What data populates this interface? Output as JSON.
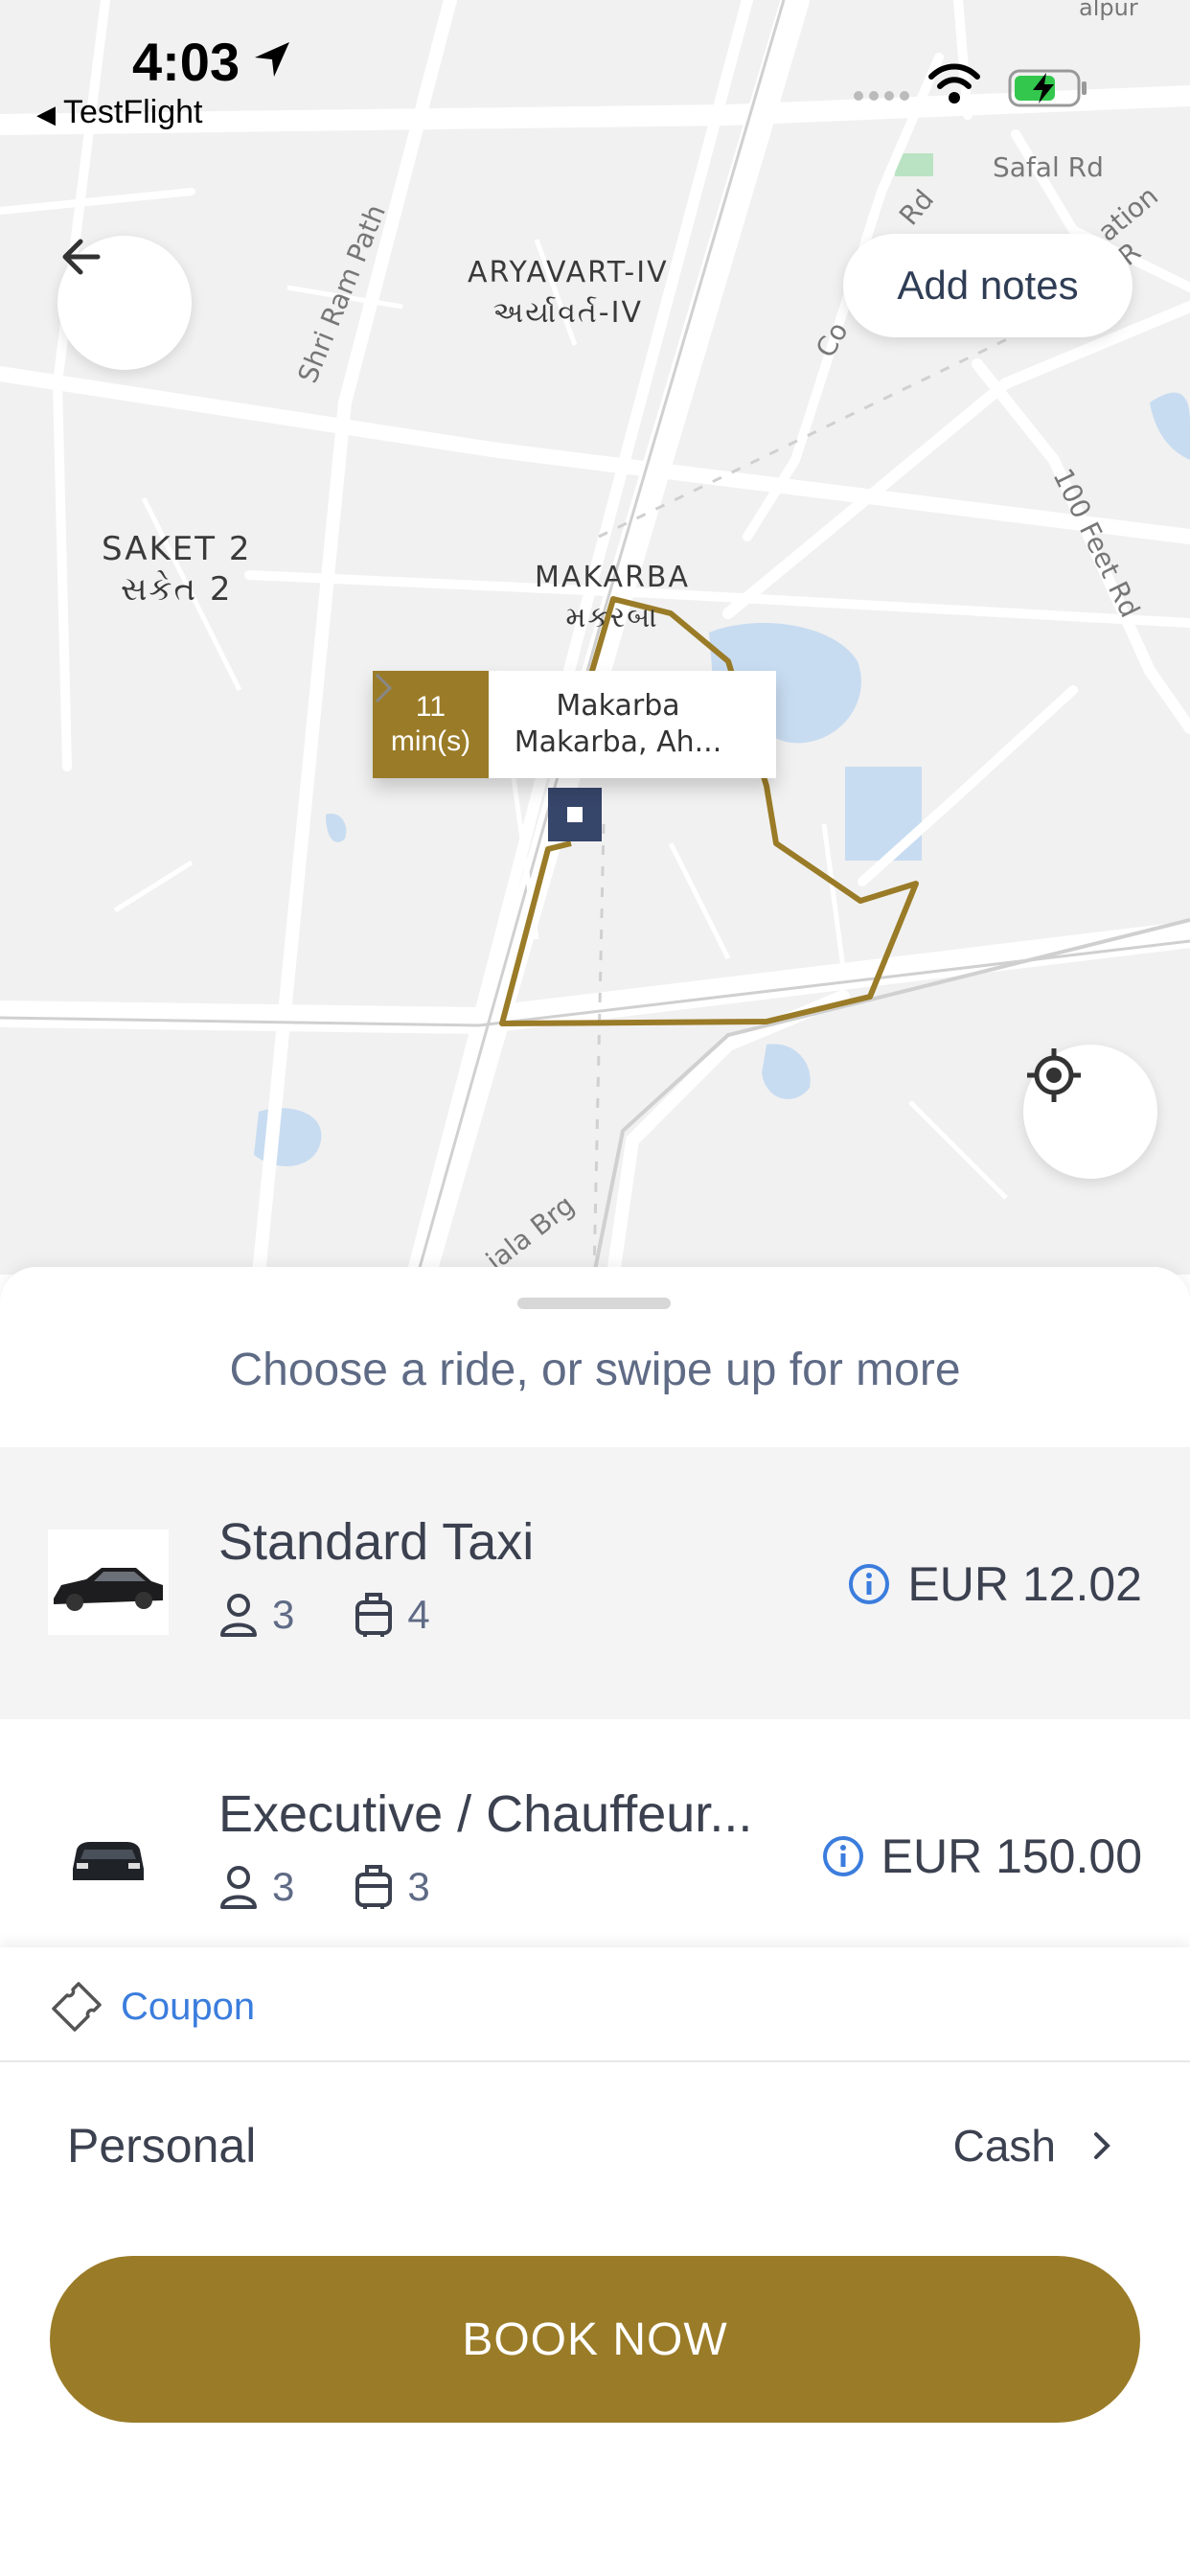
{
  "status_bar": {
    "time": "4:03",
    "back_app": "TestFlight",
    "icons": [
      "location-arrow-icon",
      "signal-dots-icon",
      "wifi-icon",
      "battery-charging-icon"
    ]
  },
  "map": {
    "area_labels": [
      {
        "name": "aryavart",
        "text": "ARYAVART-IV\nઅર્યાવર્ત-IV"
      },
      {
        "name": "saket",
        "text": "SAKET 2\nસકેત 2"
      },
      {
        "name": "makarba",
        "text": "MAKARBA\nમકરબા"
      }
    ],
    "road_labels": {
      "shri_ram_path": "Shri Ram Path",
      "safal_rd": "Safal Rd",
      "rd": "Rd",
      "co": "Co",
      "ation_r": "ation R",
      "feet_rd": "100 Feet Rd",
      "vejalpur": "alpur",
      "iala_brg": "iala Brg"
    },
    "eta": {
      "minutes": "11",
      "unit": "min(s)",
      "place": "Makarba",
      "address": "Makarba, Ah..."
    },
    "route_color": "#9a7b27"
  },
  "controls": {
    "back_icon": "arrow-left-icon",
    "add_notes": "Add notes",
    "locate_icon": "crosshair-icon"
  },
  "sheet": {
    "title": "Choose a ride, or swipe up for more",
    "rides": [
      {
        "name": "Standard Taxi",
        "passengers": "3",
        "luggage": "4",
        "price": "EUR 12.02",
        "selected": true
      },
      {
        "name": "Executive / Chauffeur...",
        "passengers": "3",
        "luggage": "3",
        "price": "EUR 150.00",
        "selected": false
      }
    ]
  },
  "footer": {
    "coupon": "Coupon",
    "profile": "Personal",
    "payment": "Cash",
    "book_button": "BOOK NOW"
  },
  "colors": {
    "accent": "#9a7b27",
    "link": "#3b7ddd",
    "text": "#3c4150",
    "muted": "#5f6b85"
  }
}
